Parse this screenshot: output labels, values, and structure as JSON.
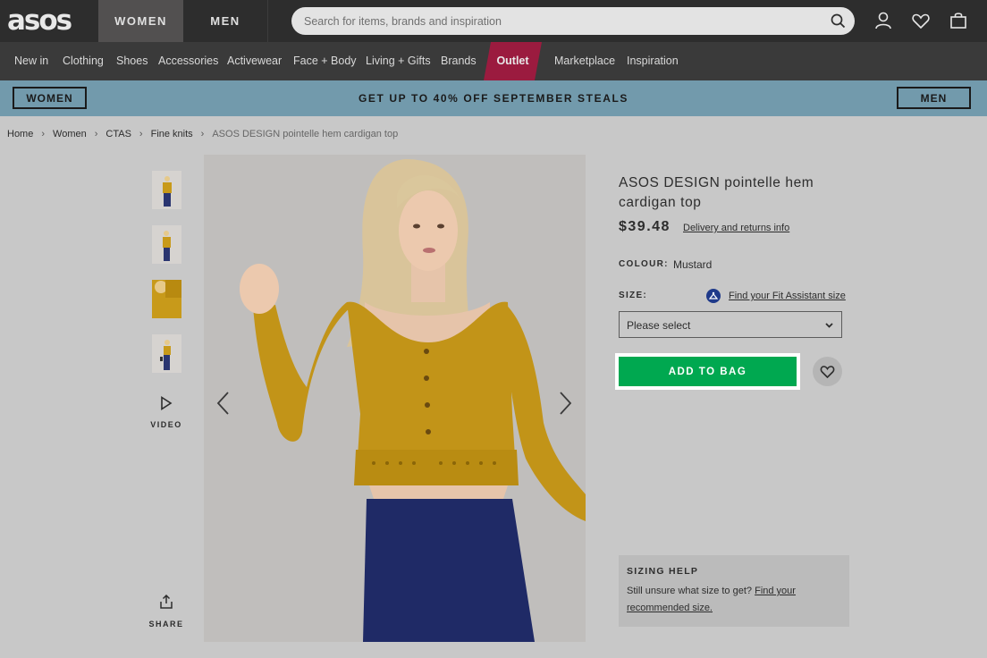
{
  "header": {
    "logo": "asos",
    "tabs": [
      {
        "label": "WOMEN"
      },
      {
        "label": "MEN"
      }
    ],
    "search": {
      "placeholder": "Search for items, brands and inspiration"
    },
    "icons": [
      "search-icon",
      "account-icon",
      "heart-icon",
      "bag-icon"
    ]
  },
  "nav": {
    "items": [
      {
        "label": "New in"
      },
      {
        "label": "Clothing"
      },
      {
        "label": "Shoes"
      },
      {
        "label": "Accessories"
      },
      {
        "label": "Activewear"
      },
      {
        "label": "Face + Body"
      },
      {
        "label": "Living + Gifts"
      },
      {
        "label": "Brands"
      },
      {
        "label": "Outlet"
      },
      {
        "label": "Marketplace"
      },
      {
        "label": "Inspiration"
      }
    ],
    "outlet_color": "#9b1b3f"
  },
  "promo": {
    "left_button": "WOMEN",
    "text": "GET UP TO 40% OFF SEPTEMBER STEALS",
    "right_button": "MEN",
    "background": "#729aac"
  },
  "breadcrumb": {
    "items": [
      "Home",
      "Women",
      "CTAS",
      "Fine knits",
      "ASOS DESIGN pointelle hem cardigan top"
    ],
    "separator": "›"
  },
  "gallery": {
    "video_label": "VIDEO",
    "share_label": "SHARE"
  },
  "product": {
    "title": "ASOS DESIGN pointelle hem cardigan top",
    "price": "$39.48",
    "delivery_link": "Delivery and returns info",
    "colour_label": "COLOUR:",
    "colour_value": "Mustard",
    "size_label": "SIZE:",
    "fit_link": "Find your Fit Assistant size",
    "size_select": "Please select",
    "add_to_bag": "ADD TO BAG",
    "add_to_bag_color": "#00a850"
  },
  "sizing_help": {
    "title": "SIZING HELP",
    "text": "Still unsure what size to get?",
    "link": "Find your recommended size."
  }
}
